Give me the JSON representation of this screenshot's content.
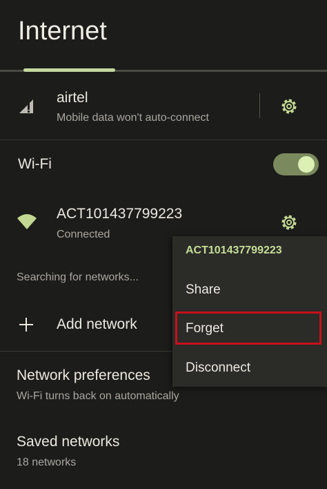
{
  "header": {
    "title": "Internet"
  },
  "mobile": {
    "name": "airtel",
    "status": "Mobile data won't auto-connect"
  },
  "wifi": {
    "label": "Wi-Fi",
    "enabled": true
  },
  "connected_network": {
    "ssid": "ACT101437799223",
    "status": "Connected"
  },
  "searching_text": "Searching for networks...",
  "add_network": {
    "label": "Add network",
    "icon": "plus-icon"
  },
  "network_preferences": {
    "title": "Network preferences",
    "subtitle": "Wi-Fi turns back on automatically"
  },
  "saved_networks": {
    "title": "Saved networks",
    "subtitle": "18 networks"
  },
  "context_menu": {
    "header": "ACT101437799223",
    "items": [
      "Share",
      "Forget",
      "Disconnect"
    ],
    "highlighted": "Forget"
  },
  "colors": {
    "accent": "#c3d893",
    "background": "#1c1c1a",
    "highlight_box": "#c8101a"
  }
}
